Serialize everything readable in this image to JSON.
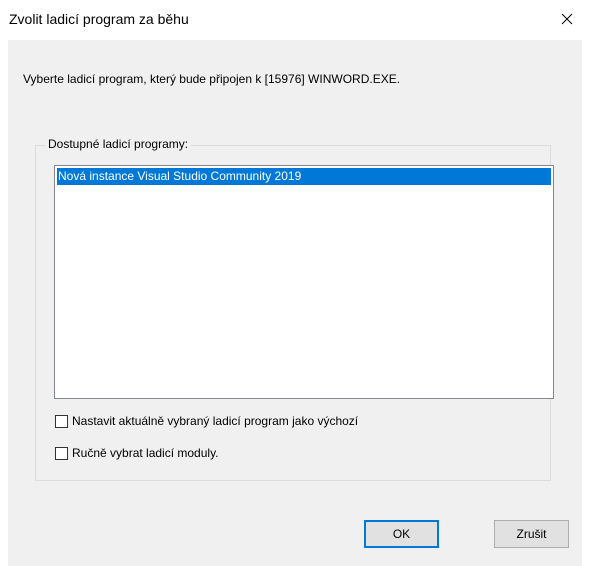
{
  "window": {
    "title": "Zvolit ladicí program za běhu",
    "close_icon": "close-icon"
  },
  "prompt": "Vyberte ladicí program, který bude připojen k [15976] WINWORD.EXE.",
  "debuggers": {
    "group_label": "Dostupné ladicí programy:",
    "items": [
      "Nová instance Visual Studio Community 2019"
    ],
    "selected_index": 0
  },
  "options": {
    "set_default_label": "Nastavit aktuálně vybraný ladicí program jako výchozí",
    "set_default_checked": false,
    "manual_modules_label": "Ručně vybrat ladicí moduly.",
    "manual_modules_checked": false
  },
  "buttons": {
    "ok_label": "OK",
    "cancel_label": "Zrušit"
  },
  "colors": {
    "selection": "#0078d7",
    "dialog_background": "#f0f0f0"
  }
}
